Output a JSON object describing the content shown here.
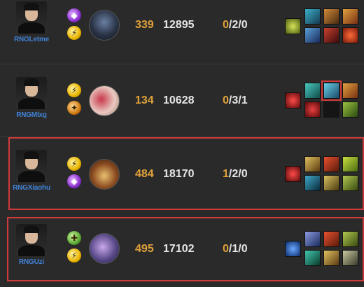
{
  "players": [
    {
      "name": "RNGLetme",
      "spells": [
        "teleport-icon",
        "flash-icon"
      ],
      "champion": "champion-portrait",
      "cs": "339",
      "gold": "12895",
      "kda": {
        "kills": "0",
        "deaths": "2",
        "assists": "0"
      },
      "items": [
        "item-1",
        "item-2",
        "item-3",
        "item-4",
        "item-5",
        "item-6",
        "item-7"
      ]
    },
    {
      "name": "RNGMlxg",
      "spells": [
        "flash-icon",
        "ignite-icon"
      ],
      "champion": "champion-portrait",
      "cs": "134",
      "gold": "10628",
      "kda": {
        "kills": "0",
        "deaths": "3",
        "assists": "1"
      },
      "items": [
        "item-1",
        "item-2",
        "item-3",
        "item-4",
        "item-5",
        "empty",
        "item-7"
      ]
    },
    {
      "name": "RNGXiaohu",
      "spells": [
        "flash-icon",
        "teleport-icon"
      ],
      "champion": "champion-portrait",
      "cs": "484",
      "gold": "18170",
      "kda": {
        "kills": "1",
        "deaths": "2",
        "assists": "0"
      },
      "items": [
        "item-1",
        "item-2",
        "item-3",
        "item-4",
        "item-5",
        "item-6",
        "item-7"
      ]
    },
    {
      "name": "RNGUzi",
      "spells": [
        "heal-icon",
        "flash-icon"
      ],
      "champion": "champion-portrait",
      "cs": "495",
      "gold": "17102",
      "kda": {
        "kills": "0",
        "deaths": "1",
        "assists": "0"
      },
      "items": [
        "item-1",
        "item-2",
        "item-3",
        "item-4",
        "item-5",
        "item-6",
        "item-7"
      ]
    }
  ],
  "colors": {
    "background": "#2a2a2a",
    "name": "#3f82d6",
    "cs": "#e0a23a",
    "highlight": "#d13a3a"
  }
}
